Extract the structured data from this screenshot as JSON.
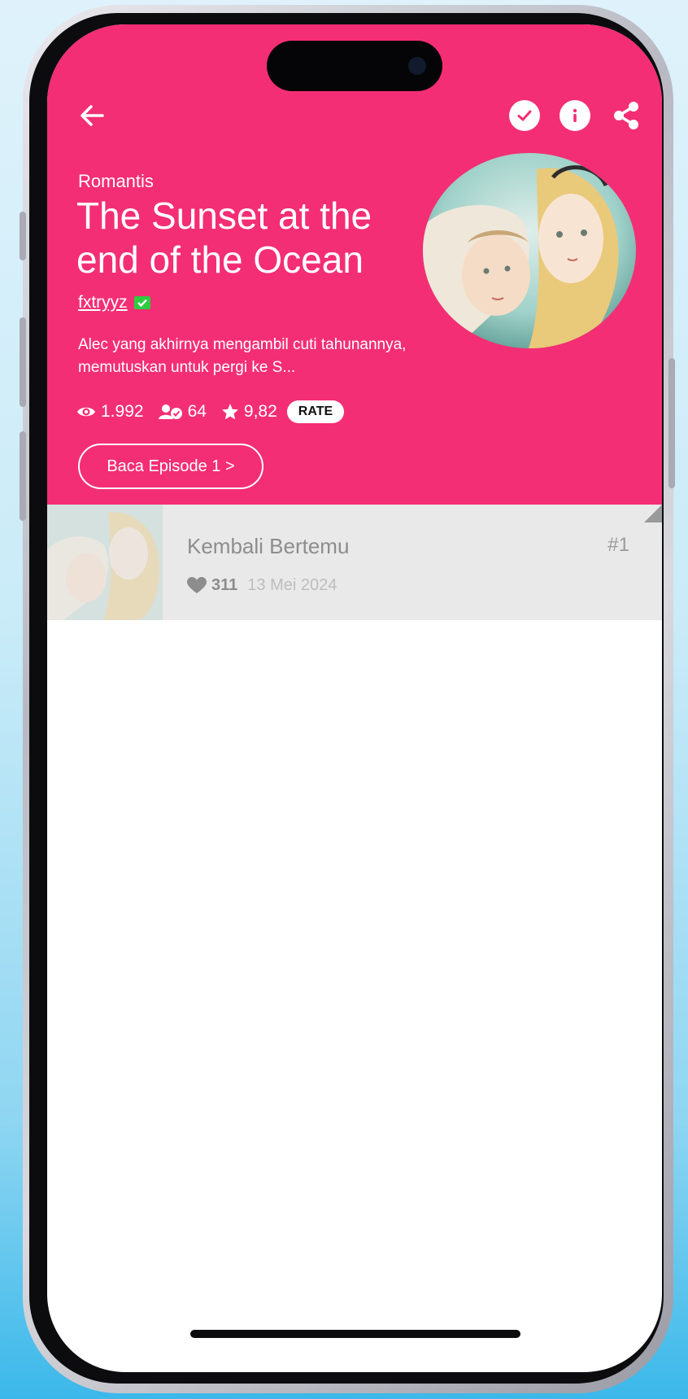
{
  "header": {
    "genre": "Romantis",
    "title": "The Sunset at the end of the Ocean",
    "author": "fxtryyz",
    "description": "Alec yang akhirnya mengambil cuti tahunannya, memutuskan untuk pergi ke S...",
    "stats": {
      "views": "1.992",
      "subscribers": "64",
      "rating": "9,82",
      "rate_label": "RATE"
    },
    "read_button_label": "Baca Episode 1 >"
  },
  "episodes": [
    {
      "title": "Kembali Bertemu",
      "likes": "311",
      "date": "13 Mei 2024",
      "number": "#1"
    }
  ],
  "icons": {
    "back": "arrow-left-icon",
    "subscribed": "check-icon",
    "info": "info-icon",
    "share": "share-icon",
    "views": "eye-icon",
    "subscribers": "user-check-icon",
    "rating": "star-icon",
    "likes": "heart-icon"
  },
  "colors": {
    "hero_background": "#f42e74",
    "episode_row_background": "#e9e9e9",
    "verified_badge": "#2ecc40"
  }
}
